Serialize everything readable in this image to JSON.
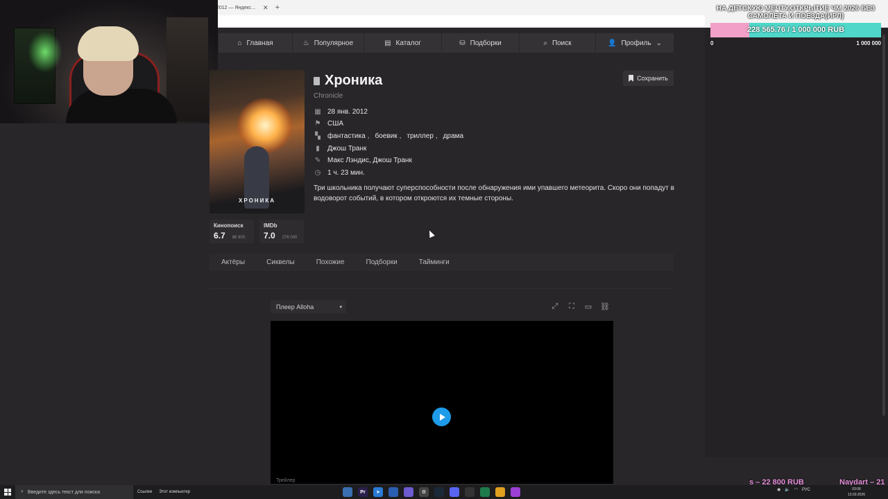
{
  "browser": {
    "tab_label": "2012 — Яндекс…",
    "tab_close": "✕",
    "new_tab": "+"
  },
  "nav": {
    "items": [
      {
        "label": "Главная",
        "icon": "home-icon",
        "glyph": "⌂"
      },
      {
        "label": "Популярное",
        "icon": "flame-icon",
        "glyph": "♨"
      },
      {
        "label": "Каталог",
        "icon": "folder-icon",
        "glyph": "▤"
      },
      {
        "label": "Подборки",
        "icon": "collection-icon",
        "glyph": "⛁"
      },
      {
        "label": "Поиск",
        "icon": "search-icon",
        "glyph": "⌕"
      },
      {
        "label": "Профиль",
        "icon": "user-icon",
        "glyph": "👤"
      }
    ],
    "profile_caret": "⌄"
  },
  "movie": {
    "title": "Хроника",
    "original_title": "Chronicle",
    "poster_text": "ХРОНИКА",
    "save_label": "Сохранить",
    "release_date": "28 янв. 2012",
    "country": "США",
    "genres": [
      "фантастика",
      "боевик",
      "триллер",
      "драма"
    ],
    "genre_separator": ",",
    "director": "Джош Транк",
    "writers": "Макс Лэндис, Джош Транк",
    "duration": "1 ч. 23 мин.",
    "description": "Три школьника получают суперспособности после обнаружения ими упавшего метеорита. Скоро они попадут в водоворот событий, в котором откроются их темные стороны."
  },
  "ratings": [
    {
      "name": "Кинопоиск",
      "value": "6.7",
      "votes": "86 900"
    },
    {
      "name": "IMDb",
      "value": "7.0",
      "votes": "276 000"
    }
  ],
  "tabs": [
    "Актёры",
    "Сиквелы",
    "Похожие",
    "Подборки",
    "Тайминги"
  ],
  "player": {
    "selected": "Плеер Alloha",
    "caret": "▾",
    "video_label": "Трейлер"
  },
  "donation": {
    "title": "НА ДЕТСКУЮ МЕЧТУ,ОТКРЫТИЕ ЧМ 2026 БЕЗ САМОЛЕТА И ПОЕЗДА(ИРЛ)",
    "amount": "228 565.76 / 1 000 000 RUB",
    "progress": 0.2286,
    "min_label": "0",
    "max_label": "1 000 000"
  },
  "ticker": {
    "left": "s – 22 800 RUB",
    "right": "Naydart – 21"
  },
  "taskbar": {
    "search_placeholder": "Введите здесь текст для поиска",
    "links_label": "Ссылки",
    "computer_label": "Этот компьютер",
    "lang": "РУС",
    "time": "03:06",
    "date": "13.03.2026"
  },
  "colors": {
    "accent_play": "#1e9be9",
    "donation_bar": "#4fd7c9",
    "donation_fill": "#f2a0c7",
    "ticker": "#e58fd9"
  }
}
